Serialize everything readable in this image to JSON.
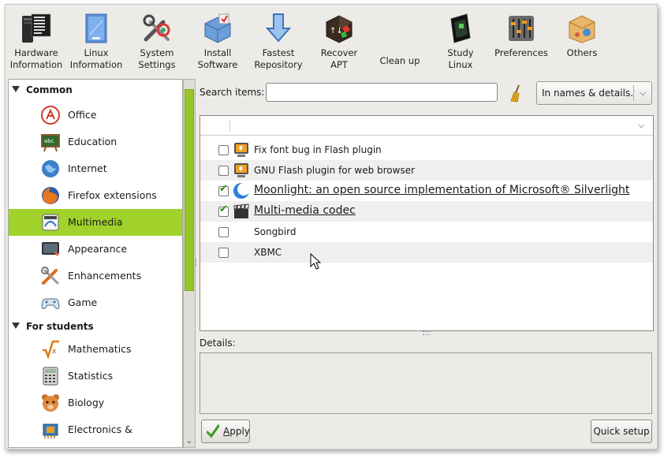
{
  "toolbar": {
    "items": [
      {
        "label": "Hardware\nInformation",
        "icon": "hardware-info-icon"
      },
      {
        "label": "Linux\nInformation",
        "icon": "linux-info-icon"
      },
      {
        "label": "System\nSettings",
        "icon": "system-settings-icon"
      },
      {
        "label": "Install\nSoftware",
        "icon": "install-software-icon"
      },
      {
        "label": "Fastest\nRepository",
        "icon": "fastest-repo-icon"
      },
      {
        "label": "Recover\nAPT",
        "icon": "recover-apt-icon"
      },
      {
        "label": "Clean up",
        "icon": ""
      },
      {
        "label": "Study\nLinux",
        "icon": "study-linux-icon"
      },
      {
        "label": "Preferences",
        "icon": "preferences-icon"
      },
      {
        "label": "Others",
        "icon": "others-icon"
      }
    ]
  },
  "sidebar": {
    "categories": [
      {
        "title": "Common",
        "items": [
          {
            "label": "Office",
            "icon": "office-icon"
          },
          {
            "label": "Education",
            "icon": "education-icon"
          },
          {
            "label": "Internet",
            "icon": "internet-icon"
          },
          {
            "label": "Firefox extensions",
            "icon": "firefox-icon"
          },
          {
            "label": "Multimedia",
            "icon": "multimedia-icon",
            "selected": true
          },
          {
            "label": "Appearance",
            "icon": "appearance-icon"
          },
          {
            "label": "Enhancements",
            "icon": "enhancements-icon"
          },
          {
            "label": "Game",
            "icon": "gamepad-icon"
          }
        ]
      },
      {
        "title": "For students",
        "items": [
          {
            "label": "Mathematics",
            "icon": "mathematics-icon"
          },
          {
            "label": "Statistics",
            "icon": "calculator-icon"
          },
          {
            "label": "Biology",
            "icon": "bear-icon"
          },
          {
            "label": "Electronics & Mechanics",
            "icon": "chip-icon"
          }
        ]
      }
    ]
  },
  "search": {
    "label": "Search items:",
    "value": "",
    "placeholder": ""
  },
  "search_mode": {
    "selected": "In names & details."
  },
  "list": {
    "rows": [
      {
        "label": "Fix font bug in Flash plugin",
        "checked": false,
        "icon": "flash-plugin-icon",
        "emphasis": false
      },
      {
        "label": "GNU Flash plugin for web browser",
        "checked": false,
        "icon": "flash-plugin-icon",
        "emphasis": false
      },
      {
        "label": "Moonlight: an open source implementation of Microsoft® Silverlight",
        "checked": true,
        "icon": "moonlight-icon",
        "emphasis": true
      },
      {
        "label": "Multi-media codec",
        "checked": true,
        "icon": "clapperboard-icon",
        "emphasis": true
      },
      {
        "label": "Songbird",
        "checked": false,
        "icon": "",
        "emphasis": false
      },
      {
        "label": "XBMC",
        "checked": false,
        "icon": "",
        "emphasis": false
      }
    ]
  },
  "details": {
    "label": "Details:",
    "text": ""
  },
  "buttons": {
    "apply_underlined": "A",
    "apply_rest": "pply",
    "quick_setup": "Quick setup"
  },
  "colors": {
    "selection": "#a1d22c",
    "scroll_thumb": "#96c724",
    "checkmark": "#2e8b0a"
  }
}
